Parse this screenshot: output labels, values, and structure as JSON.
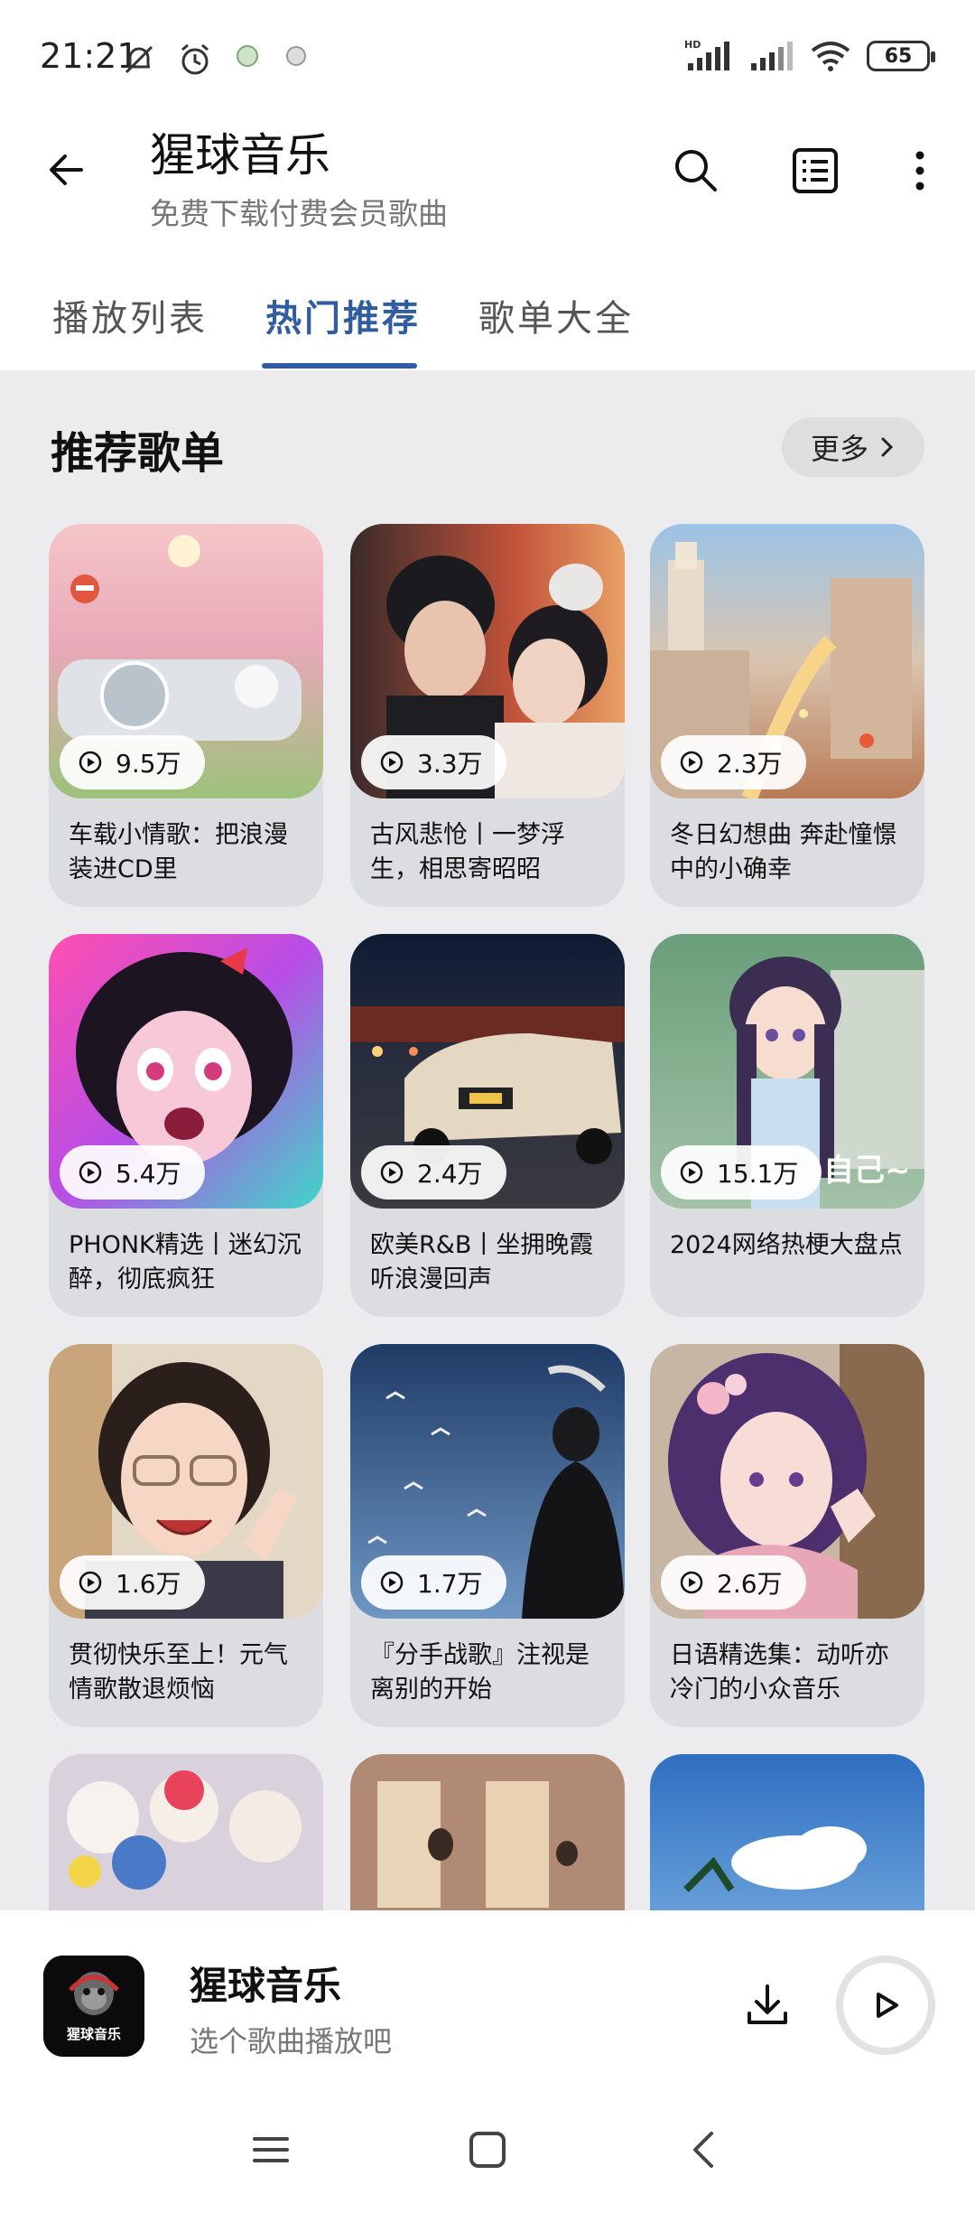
{
  "status": {
    "time": "21:21",
    "battery": "65",
    "network_label": "HD"
  },
  "header": {
    "title": "猩球音乐",
    "subtitle": "免费下载付费会员歌曲"
  },
  "tabs": [
    {
      "label": "播放列表",
      "active": false
    },
    {
      "label": "热门推荐",
      "active": true
    },
    {
      "label": "歌单大全",
      "active": false
    }
  ],
  "section": {
    "title": "推荐歌单",
    "more_label": "更多"
  },
  "playlists": [
    {
      "plays": "9.5万",
      "title": "车载小情歌：把浪漫装进CD里"
    },
    {
      "plays": "3.3万",
      "title": "古风悲怆丨一梦浮生，相思寄昭昭"
    },
    {
      "plays": "2.3万",
      "title": "冬日幻想曲 奔赴憧憬中的小确幸"
    },
    {
      "plays": "5.4万",
      "title": "PHONK精选丨迷幻沉醉，彻底疯狂"
    },
    {
      "plays": "2.4万",
      "title": "欧美R&B丨坐拥晚霞听浪漫回声"
    },
    {
      "plays": "15.1万",
      "title": "2024网络热梗大盘点"
    },
    {
      "plays": "1.6万",
      "title": "贯彻快乐至上！元气情歌散退烦恼"
    },
    {
      "plays": "1.7万",
      "title": "『分手战歌』注视是离别的开始"
    },
    {
      "plays": "2.6万",
      "title": "日语精选集：动听亦冷门的小众音乐"
    }
  ],
  "cover_overlay_text": "自己~",
  "player": {
    "title": "猩球音乐",
    "subtitle": "选个歌曲播放吧",
    "cover_text": "猩球音乐"
  },
  "colors": {
    "accent": "#2f5d9f",
    "content_bg": "#ececee",
    "card_bg": "#dcdde0"
  }
}
